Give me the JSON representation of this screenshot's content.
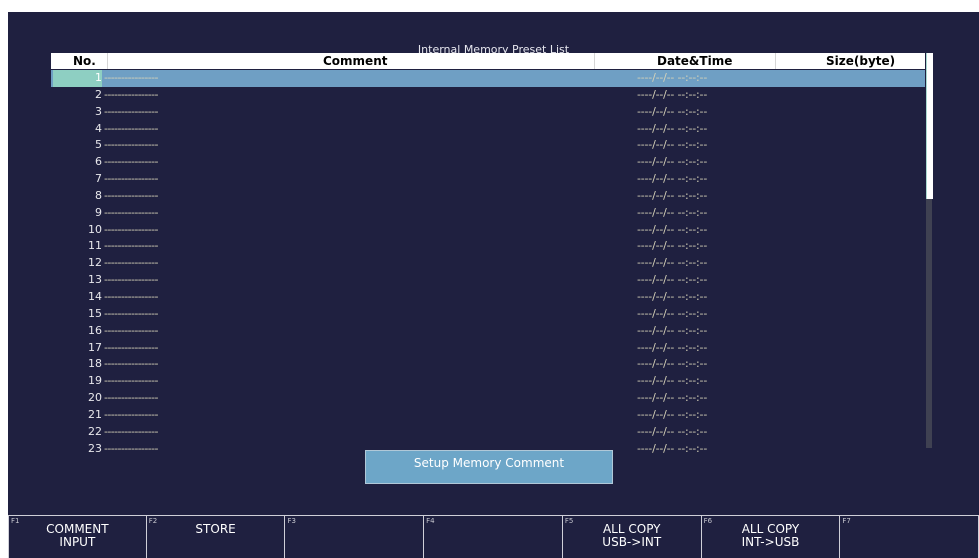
{
  "title": "Internal Memory Preset List",
  "table": {
    "headers": {
      "no": "No.",
      "comment": "Comment",
      "datetime": "Date&Time",
      "size": "Size(byte)"
    },
    "rows": [
      {
        "no": "1",
        "comment": "----------------",
        "datetime": "----/--/-- --:--:--",
        "size": ""
      },
      {
        "no": "2",
        "comment": "----------------",
        "datetime": "----/--/-- --:--:--",
        "size": ""
      },
      {
        "no": "3",
        "comment": "----------------",
        "datetime": "----/--/-- --:--:--",
        "size": ""
      },
      {
        "no": "4",
        "comment": "----------------",
        "datetime": "----/--/-- --:--:--",
        "size": ""
      },
      {
        "no": "5",
        "comment": "----------------",
        "datetime": "----/--/-- --:--:--",
        "size": ""
      },
      {
        "no": "6",
        "comment": "----------------",
        "datetime": "----/--/-- --:--:--",
        "size": ""
      },
      {
        "no": "7",
        "comment": "----------------",
        "datetime": "----/--/-- --:--:--",
        "size": ""
      },
      {
        "no": "8",
        "comment": "----------------",
        "datetime": "----/--/-- --:--:--",
        "size": ""
      },
      {
        "no": "9",
        "comment": "----------------",
        "datetime": "----/--/-- --:--:--",
        "size": ""
      },
      {
        "no": "10",
        "comment": "----------------",
        "datetime": "----/--/-- --:--:--",
        "size": ""
      },
      {
        "no": "11",
        "comment": "----------------",
        "datetime": "----/--/-- --:--:--",
        "size": ""
      },
      {
        "no": "12",
        "comment": "----------------",
        "datetime": "----/--/-- --:--:--",
        "size": ""
      },
      {
        "no": "13",
        "comment": "----------------",
        "datetime": "----/--/-- --:--:--",
        "size": ""
      },
      {
        "no": "14",
        "comment": "----------------",
        "datetime": "----/--/-- --:--:--",
        "size": ""
      },
      {
        "no": "15",
        "comment": "----------------",
        "datetime": "----/--/-- --:--:--",
        "size": ""
      },
      {
        "no": "16",
        "comment": "----------------",
        "datetime": "----/--/-- --:--:--",
        "size": ""
      },
      {
        "no": "17",
        "comment": "----------------",
        "datetime": "----/--/-- --:--:--",
        "size": ""
      },
      {
        "no": "18",
        "comment": "----------------",
        "datetime": "----/--/-- --:--:--",
        "size": ""
      },
      {
        "no": "19",
        "comment": "----------------",
        "datetime": "----/--/-- --:--:--",
        "size": ""
      },
      {
        "no": "20",
        "comment": "----------------",
        "datetime": "----/--/-- --:--:--",
        "size": ""
      },
      {
        "no": "21",
        "comment": "----------------",
        "datetime": "----/--/-- --:--:--",
        "size": ""
      },
      {
        "no": "22",
        "comment": "----------------",
        "datetime": "----/--/-- --:--:--",
        "size": ""
      },
      {
        "no": "23",
        "comment": "----------------",
        "datetime": "----/--/-- --:--:--",
        "size": ""
      }
    ],
    "selected_row": 1
  },
  "setup_button": "Setup Memory Comment",
  "fkeys": [
    {
      "tag": "F1",
      "line1": "COMMENT",
      "line2": "INPUT"
    },
    {
      "tag": "F2",
      "line1": "STORE",
      "line2": ""
    },
    {
      "tag": "F3",
      "line1": "",
      "line2": ""
    },
    {
      "tag": "F4",
      "line1": "",
      "line2": ""
    },
    {
      "tag": "F5",
      "line1": "ALL COPY",
      "line2": "USB->INT"
    },
    {
      "tag": "F6",
      "line1": "ALL COPY",
      "line2": "INT->USB"
    },
    {
      "tag": "F7",
      "line1": "",
      "line2": ""
    }
  ],
  "colors": {
    "background": "#1f2040",
    "selected_row": "#6f9fc4",
    "button": "#6da6c8"
  }
}
